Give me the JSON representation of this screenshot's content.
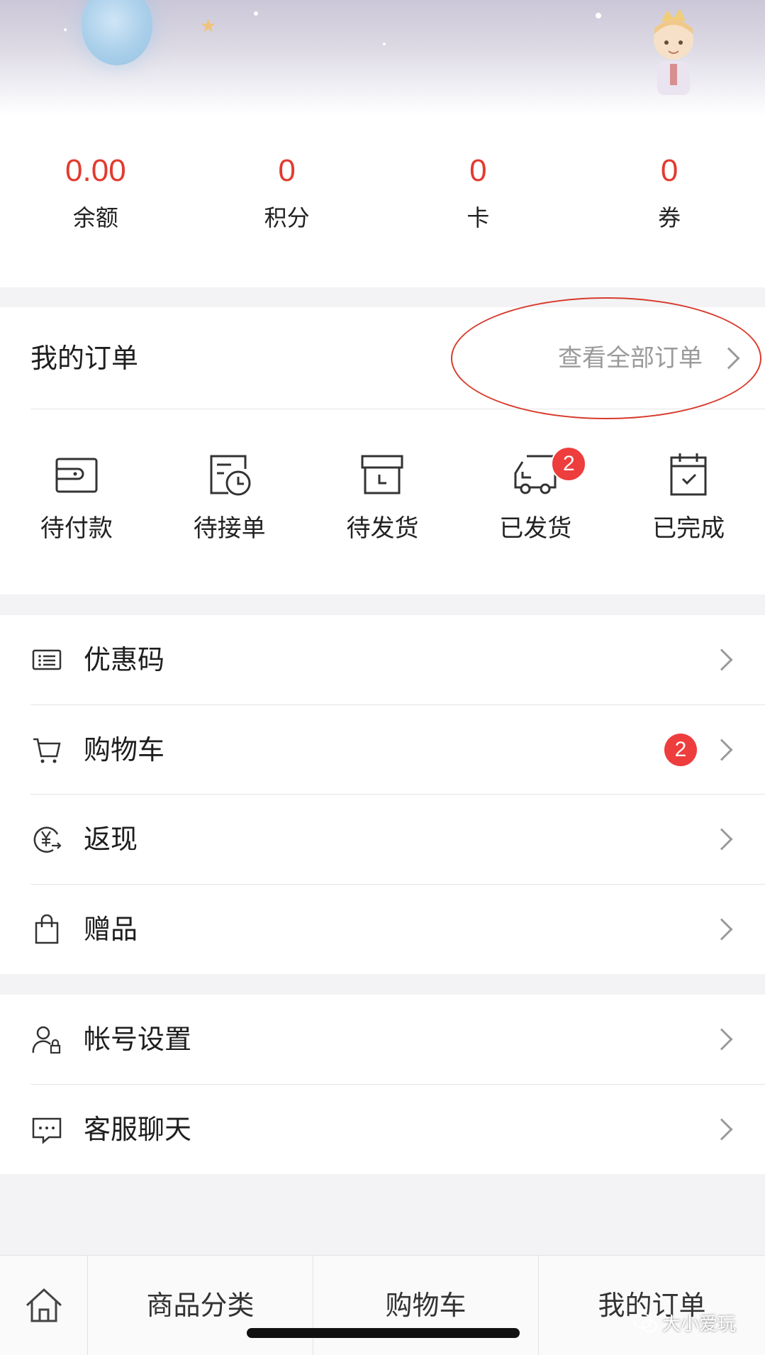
{
  "stats": [
    {
      "value": "0.00",
      "label": "余额"
    },
    {
      "value": "0",
      "label": "积分"
    },
    {
      "value": "0",
      "label": "卡"
    },
    {
      "value": "0",
      "label": "券"
    }
  ],
  "orders": {
    "title": "我的订单",
    "view_all": "查看全部订单",
    "statuses": [
      {
        "label": "待付款",
        "icon": "wallet-icon"
      },
      {
        "label": "待接单",
        "icon": "clock-document-icon"
      },
      {
        "label": "待发货",
        "icon": "box-icon"
      },
      {
        "label": "已发货",
        "icon": "truck-icon",
        "badge": "2"
      },
      {
        "label": "已完成",
        "icon": "calendar-check-icon"
      }
    ]
  },
  "menu": {
    "group1": [
      {
        "label": "优惠码",
        "icon": "coupon-list-icon"
      },
      {
        "label": "购物车",
        "icon": "cart-icon",
        "badge": "2"
      },
      {
        "label": "返现",
        "icon": "yuan-cashback-icon"
      },
      {
        "label": "赠品",
        "icon": "gift-bag-icon"
      }
    ],
    "group2": [
      {
        "label": "帐号设置",
        "icon": "user-lock-icon"
      },
      {
        "label": "客服聊天",
        "icon": "chat-icon"
      }
    ]
  },
  "tabbar": {
    "home_icon": "home-icon",
    "tabs": [
      "商品分类",
      "购物车",
      "我的订单"
    ]
  },
  "watermark": "大小爱玩",
  "colors": {
    "accent": "#e23b2f",
    "badge": "#ee3d3d",
    "annotation": "#d83a2c"
  }
}
